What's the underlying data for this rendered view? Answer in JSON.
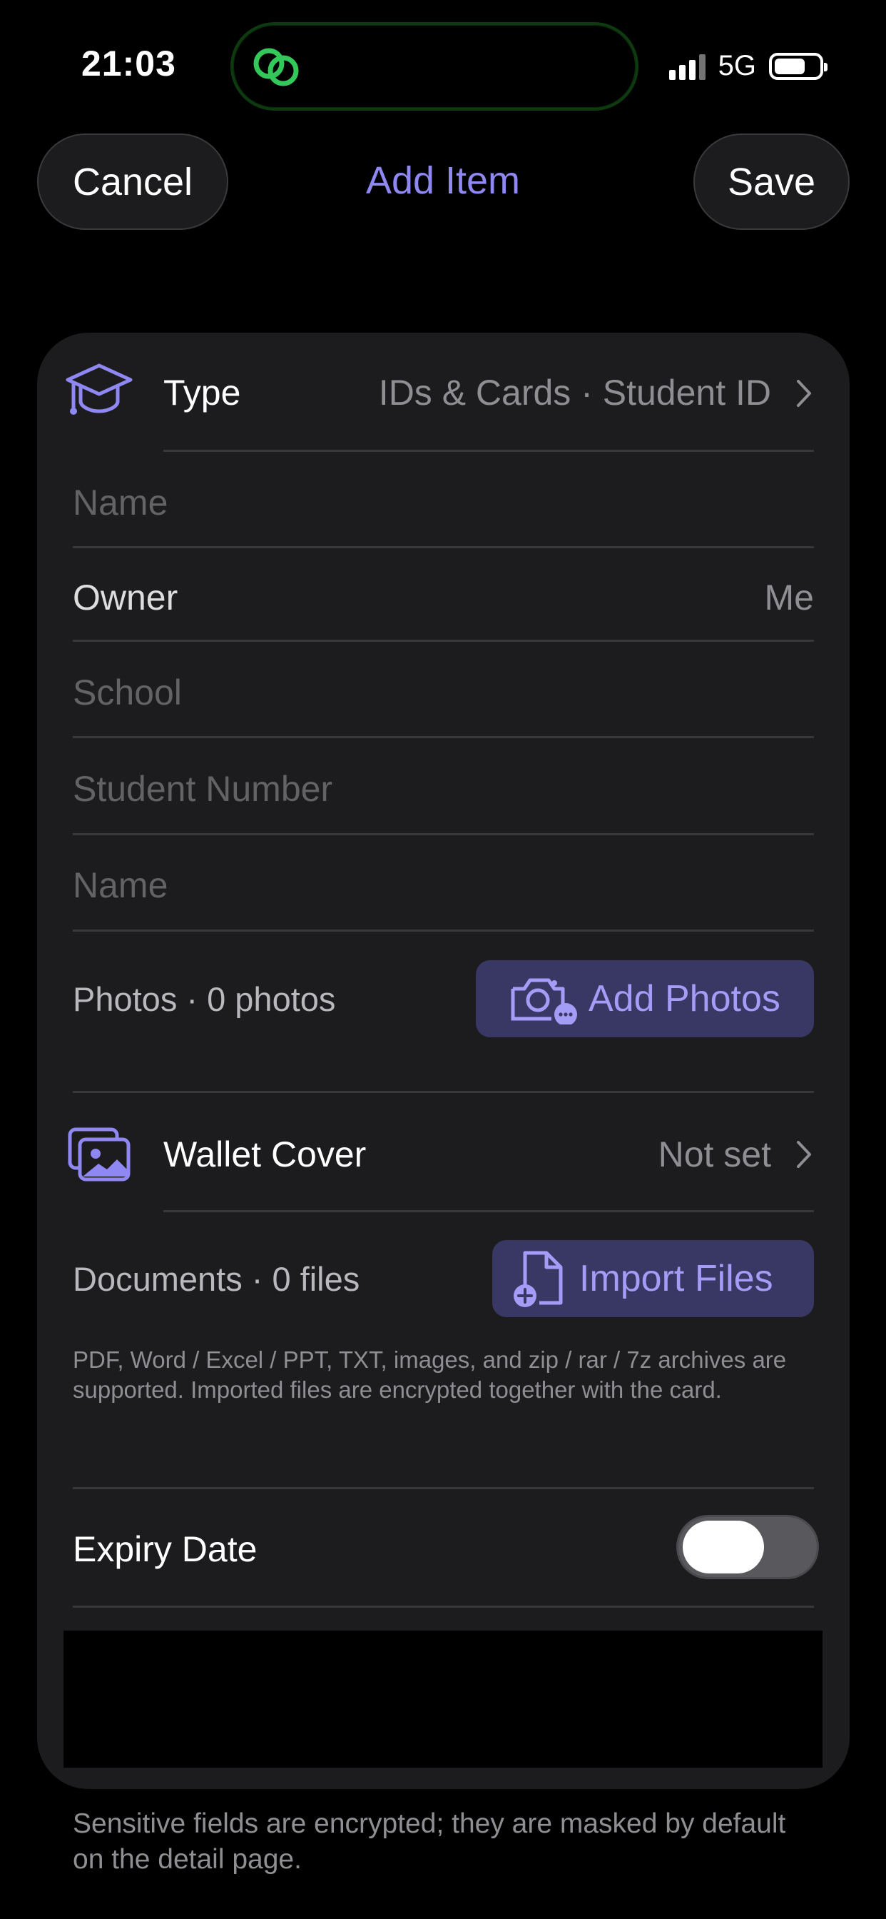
{
  "status_bar": {
    "time": "21:03",
    "network": "5G",
    "signal_bars": 4,
    "battery_level": 0.7,
    "island_icon": "link-icon"
  },
  "nav": {
    "cancel_label": "Cancel",
    "title": "Add Item",
    "save_label": "Save"
  },
  "form": {
    "type": {
      "icon": "graduation-cap-icon",
      "label": "Type",
      "value": "IDs & Cards · Student ID"
    },
    "name_placeholder": "Name",
    "owner": {
      "label": "Owner",
      "value": "Me"
    },
    "school_placeholder": "School",
    "student_number_placeholder": "Student Number",
    "name2_placeholder": "Name",
    "photos": {
      "label": "Photos · 0 photos",
      "button_label": "Add Photos",
      "button_icon": "camera-more-icon"
    },
    "wallet_cover": {
      "icon": "photos-icon",
      "label": "Wallet Cover",
      "value": "Not set"
    },
    "documents": {
      "label": "Documents · 0 files",
      "button_label": "Import Files",
      "button_icon": "file-add-icon",
      "help": "PDF, Word / Excel / PPT, TXT, images, and zip / rar / 7z archives are supported. Imported files are encrypted together with the card."
    },
    "expiry": {
      "label": "Expiry Date",
      "enabled": false
    }
  },
  "footer_note": "Sensitive fields are encrypted; they are masked by default on the detail page.",
  "colors": {
    "accent": "#8f88f2",
    "card_bg": "#1c1c1e",
    "button_bg": "#393864",
    "island_icon": "#34c759"
  }
}
